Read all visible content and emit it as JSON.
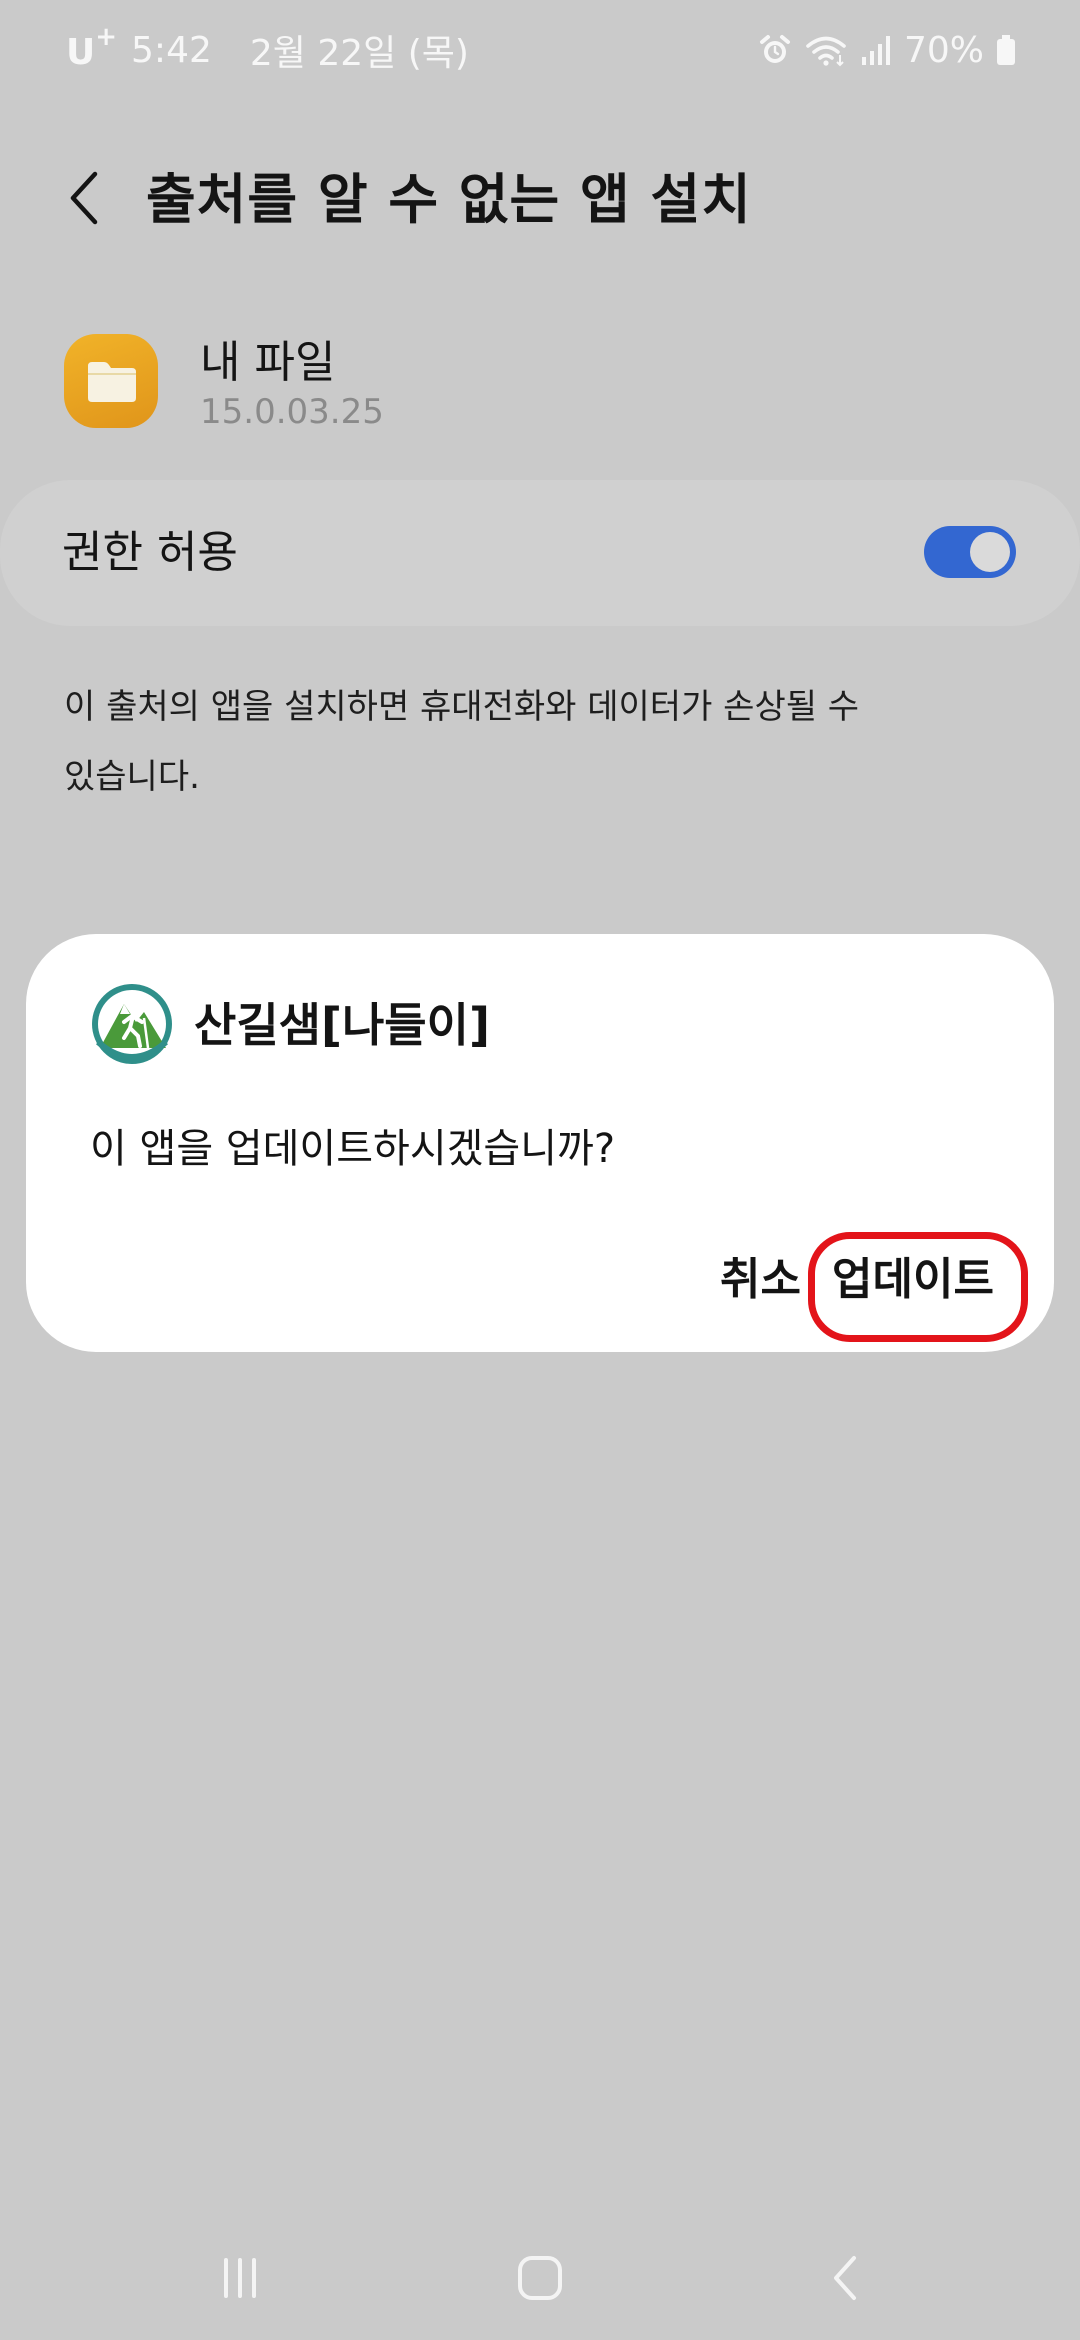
{
  "status_bar": {
    "carrier": "U",
    "carrier_sup": "+",
    "time": "5:42",
    "date": "2월 22일 (목)",
    "battery": "70%"
  },
  "header": {
    "title": "출처를 알 수 없는 앱 설치"
  },
  "source_app": {
    "name": "내 파일",
    "version": "15.0.03.25",
    "icon": "folder-icon",
    "icon_color": "#ECA724"
  },
  "permission": {
    "label": "권한 허용",
    "enabled": true,
    "toggle_color": "#3367D1"
  },
  "warning": {
    "text": "이 출처의 앱을 설치하면 휴대전화와 데이터가 손상될 수 있습니다."
  },
  "dialog": {
    "app_name": "산길샘[나들이]",
    "app_icon": "hiker-mountain-icon",
    "message": "이 앱을 업데이트하시겠습니까?",
    "cancel_label": "취소",
    "update_label": "업데이트",
    "highlight_color": "#E3141A"
  },
  "nav_bar": {
    "recents_icon": "recents-icon",
    "home_icon": "home-icon",
    "back_icon": "back-icon"
  }
}
